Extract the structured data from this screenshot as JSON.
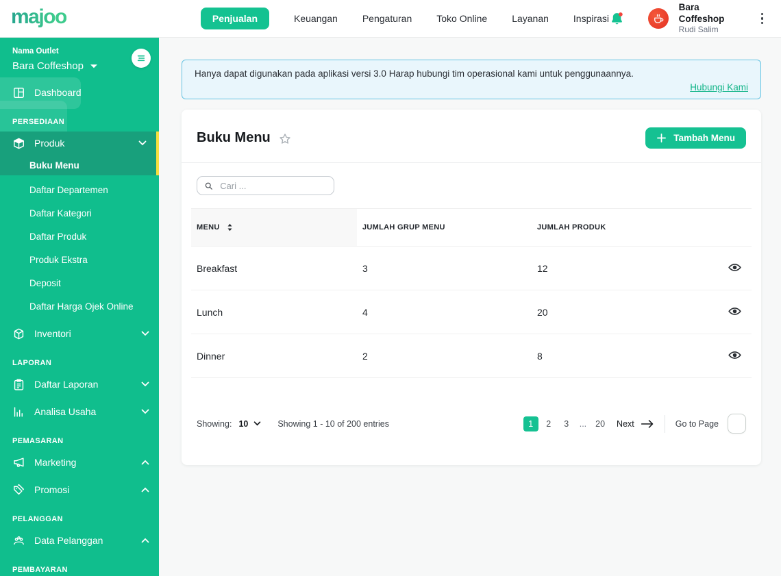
{
  "colors": {
    "accent": "#14C291",
    "sidebar_bg": "#10BE8D",
    "sidebar_active_bg": "#18A07C",
    "active_highlight": "#F7DF3F",
    "banner_bg": "#E9F6FC",
    "banner_border": "#65C3E2",
    "link": "#10B487",
    "avatar_bg": "#E8392A"
  },
  "brand": {
    "logo_text": "majoo"
  },
  "topnav": {
    "items": [
      {
        "label": "Penjualan",
        "active": true
      },
      {
        "label": "Keuangan",
        "active": false
      },
      {
        "label": "Pengaturan",
        "active": false
      },
      {
        "label": "Toko Online",
        "active": false
      },
      {
        "label": "Layanan",
        "active": false
      },
      {
        "label": "Inspirasi",
        "active": false
      }
    ]
  },
  "user": {
    "name": "Bara Coffeshop",
    "subtitle": "Rudi Salim"
  },
  "sidebar": {
    "outlet_label": "Nama Outlet",
    "outlet_name": "Bara Coffeshop",
    "dashboard": "Dashboard",
    "section_persediaan": "PERSEDIAAN",
    "produk": "Produk",
    "sub_buku_menu": "Buku Menu",
    "sub_daftar_departemen": "Daftar Departemen",
    "sub_daftar_kategori": "Daftar Kategori",
    "sub_daftar_produk": "Daftar Produk",
    "sub_produk_ekstra": "Produk Ekstra",
    "sub_deposit": "Deposit",
    "sub_daftar_harga_ojek_online": "Daftar Harga Ojek Online",
    "inventori": "Inventori",
    "section_laporan": "LAPORAN",
    "daftar_laporan": "Daftar Laporan",
    "analisa_usaha": "Analisa Usaha",
    "section_pemasaran": "PEMASARAN",
    "marketing": "Marketing",
    "promosi": "Promosi",
    "section_pelanggan": "PELANGGAN",
    "data_pelanggan": "Data Pelanggan",
    "section_pembayaran": "PEMBAYARAN"
  },
  "banner": {
    "text": "Hanya dapat digunakan pada aplikasi versi 3.0 Harap hubungi tim operasional kami untuk penggunaannya.",
    "link": "Hubungi Kami"
  },
  "card": {
    "title": "Buku Menu",
    "add_button": "Tambah Menu",
    "search_placeholder": "Cari ...",
    "table": {
      "headers": [
        "MENU",
        "JUMLAH GRUP MENU",
        "JUMLAH PRODUK"
      ],
      "rows": [
        {
          "menu": "Breakfast",
          "groups": "3",
          "products": "12"
        },
        {
          "menu": "Lunch",
          "groups": "4",
          "products": "20"
        },
        {
          "menu": "Dinner",
          "groups": "2",
          "products": "8"
        }
      ]
    },
    "pagination": {
      "showing_label": "Showing:",
      "page_size": "10",
      "summary": "Showing 1 - 10 of 200 entries",
      "pages": [
        "1",
        "2",
        "3",
        "...",
        "20"
      ],
      "active_page": "1",
      "next_label": "Next",
      "goto_label": "Go to Page",
      "goto_value": ""
    }
  }
}
